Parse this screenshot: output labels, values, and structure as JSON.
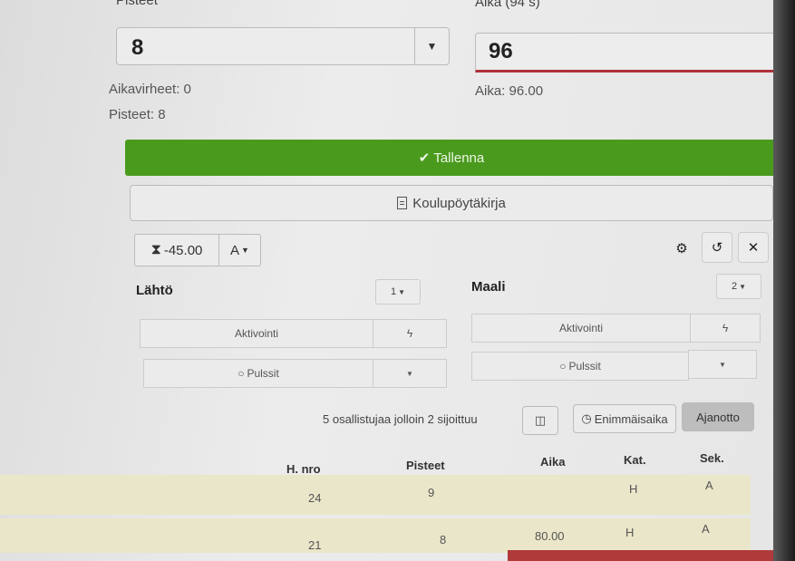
{
  "top_labels": {
    "points_label": "Pisteet",
    "time_label": "Aika (94 s)"
  },
  "points_select": {
    "value": "8"
  },
  "time_input": {
    "value": "96"
  },
  "info": {
    "time_faults": "Aikavirheet: 0",
    "points": "Pisteet: 8",
    "time": "Aika: 96.00"
  },
  "buttons": {
    "save": "Tallenna",
    "report": "Koulupöytäkirja"
  },
  "timer": {
    "offset": "-45.00",
    "mode": "A"
  },
  "start": {
    "title": "Lähtö",
    "select": "1",
    "activation": "Aktivointi",
    "pulses": "Pulssit"
  },
  "finish": {
    "title": "Maali",
    "select": "2",
    "activation": "Aktivointi",
    "pulses": "Pulssit"
  },
  "toolbar": {
    "summary": "5 osallistujaa jolloin 2 sijoittuu",
    "max_time": "Enimmäisaika",
    "timing": "Ajanotto"
  },
  "table": {
    "headers": [
      "H. nro",
      "Pisteet",
      "Aika",
      "Kat.",
      "Sek."
    ],
    "rows": [
      [
        "24",
        "9",
        "",
        "H",
        "A"
      ],
      [
        "21",
        "8",
        "80.00",
        "H",
        "A"
      ]
    ]
  },
  "colors": {
    "save_green": "#4a9a1e",
    "accent_red": "#b0303a",
    "row_bg": "#eae6c9"
  }
}
